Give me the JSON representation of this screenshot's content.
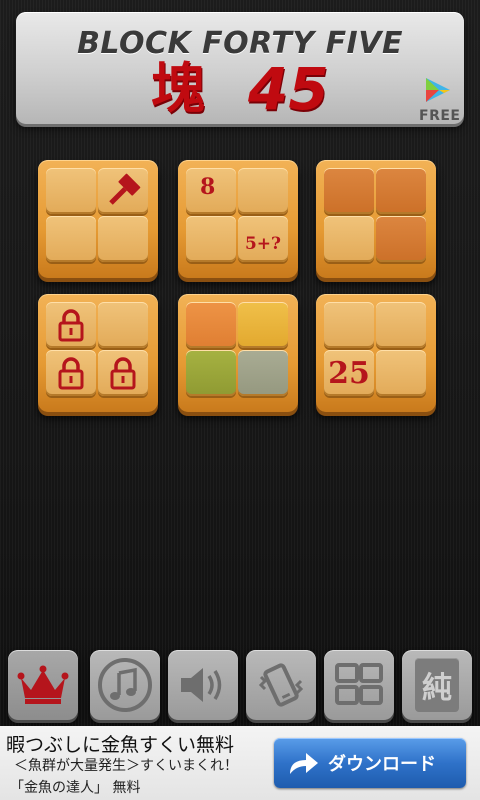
{
  "banner": {
    "title_en": "BLOCK FORTY FIVE",
    "title_kanji": "塊",
    "title_num": "45",
    "free_label": "FREE"
  },
  "levels": {
    "tile3": {
      "number": "8",
      "equation": "5+?"
    },
    "tile6": {
      "number": "25"
    }
  },
  "colors": {
    "tile_orange": "#e59a33",
    "red_icon": "#b5151c",
    "color_tile_orange": "#e58a3a",
    "color_tile_yellow": "#e6b23a",
    "color_tile_olive": "#9aa43a",
    "color_tile_gray": "#a0a38a",
    "rust_cell": "#d47a30"
  },
  "toolbar": {
    "items": [
      "crown-icon",
      "music-icon",
      "speaker-icon",
      "vibrate-icon",
      "grid-icon",
      "kanji-icon"
    ],
    "kanji_label": "純"
  },
  "ad": {
    "line1": "暇つぶしに金魚すくい無料",
    "line2": "＜魚群が大量発生＞すくいまくれ！",
    "line3": "「金魚の達人」 無料",
    "button_label": "ダウンロード"
  }
}
